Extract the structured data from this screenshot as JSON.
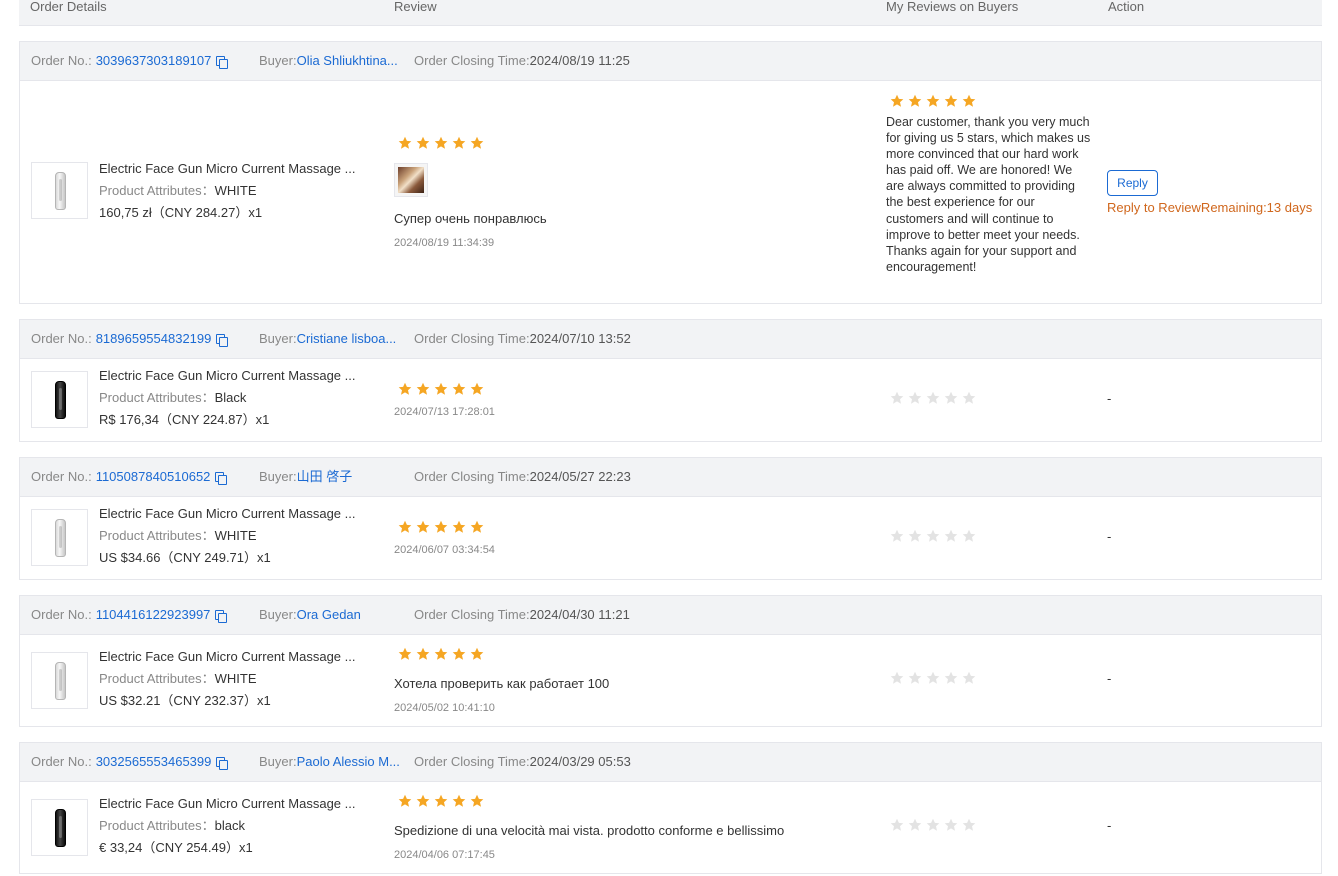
{
  "columns": {
    "order_details": "Order Details",
    "review": "Review",
    "my_reviews": "My Reviews on Buyers",
    "action": "Action"
  },
  "labels": {
    "order_no": "Order No.:",
    "buyer": "Buyer:",
    "closing_time": "Order Closing Time:",
    "product_attributes": "Product Attributes："
  },
  "colors": {
    "link": "#1b6ad3",
    "star": "#f5a623",
    "star_empty": "#e3e3e3",
    "remaining": "#d0671d"
  },
  "orders": [
    {
      "order_no": "3039637303189107",
      "buyer": "Olia Shliukhtina...",
      "closing_time": "2024/08/19 11:25",
      "product_title": "Electric Face Gun Micro Current Massage ...",
      "attribute": "WHITE",
      "price": "160,75 zł（CNY  284.27）x1",
      "device_color": "white",
      "rating": 5,
      "has_photo": true,
      "review_text": "Супер очень понравлюсь",
      "review_date": "2024/08/19 11:34:39",
      "my_rating": 5,
      "my_reply": "Dear customer, thank you very much for giving us 5 stars, which makes us more convinced that our hard work has paid off. We are honored! We are always committed to providing the best experience for our customers and will continue to improve to better meet your needs. Thanks again for your support and encouragement!",
      "action": {
        "button": "Reply",
        "remaining": "Reply to ReviewRemaining:13 days"
      }
    },
    {
      "order_no": "8189659554832199",
      "buyer": "Cristiane lisboa...",
      "closing_time": "2024/07/10 13:52",
      "product_title": "Electric Face Gun Micro Current Massage ...",
      "attribute": "Black",
      "price": "R$ 176,34（CNY  224.87）x1",
      "device_color": "black",
      "rating": 5,
      "has_photo": false,
      "review_text": "",
      "review_date": "2024/07/13 17:28:01",
      "my_rating": 0,
      "my_reply": "",
      "action": {
        "dash": "-"
      }
    },
    {
      "order_no": "1105087840510652",
      "buyer": "山田 啓子",
      "closing_time": "2024/05/27 22:23",
      "product_title": "Electric Face Gun Micro Current Massage ...",
      "attribute": "WHITE",
      "price": "US $34.66（CNY  249.71）x1",
      "device_color": "white",
      "rating": 5,
      "has_photo": false,
      "review_text": "",
      "review_date": "2024/06/07 03:34:54",
      "my_rating": 0,
      "my_reply": "",
      "action": {
        "dash": "-"
      }
    },
    {
      "order_no": "1104416122923997",
      "buyer": "Ora Gedan",
      "closing_time": "2024/04/30 11:21",
      "product_title": "Electric Face Gun Micro Current Massage ...",
      "attribute": "WHITE",
      "price": "US $32.21（CNY  232.37）x1",
      "device_color": "white",
      "rating": 5,
      "has_photo": false,
      "review_text": "Хотела проверить как работает 100",
      "review_date": "2024/05/02 10:41:10",
      "my_rating": 0,
      "my_reply": "",
      "action": {
        "dash": "-"
      }
    },
    {
      "order_no": "3032565553465399",
      "buyer": "Paolo Alessio M...",
      "closing_time": "2024/03/29 05:53",
      "product_title": "Electric Face Gun Micro Current Massage ...",
      "attribute": "black",
      "price": "€ 33,24（CNY  254.49）x1",
      "device_color": "black",
      "rating": 5,
      "has_photo": false,
      "review_text": "Spedizione di una velocità mai vista. prodotto conforme e bellissimo",
      "review_date": "2024/04/06 07:17:45",
      "my_rating": 0,
      "my_reply": "",
      "action": {
        "dash": "-"
      }
    }
  ]
}
